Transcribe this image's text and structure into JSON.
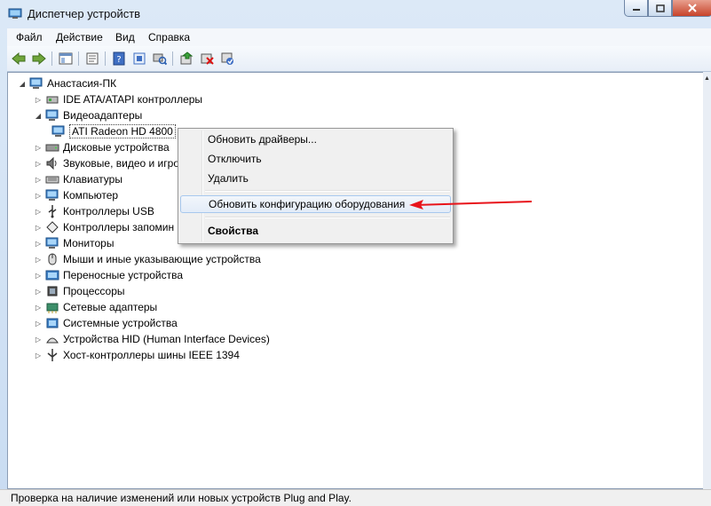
{
  "window": {
    "title": "Диспетчер устройств"
  },
  "menu": {
    "file": "Файл",
    "action": "Действие",
    "view": "Вид",
    "help": "Справка"
  },
  "tree": {
    "root": "Анастасия-ПК",
    "ide": "IDE ATA/ATAPI контроллеры",
    "video": "Видеоадаптеры",
    "video_child": "ATI Radeon HD 4800",
    "disks": "Дисковые устройства",
    "sound": "Звуковые, видео и игро",
    "keyboards": "Клавиатуры",
    "computer": "Компьютер",
    "usb": "Контроллеры USB",
    "storage": "Контроллеры запомин",
    "monitors": "Мониторы",
    "mice": "Мыши и иные указывающие устройства",
    "portable": "Переносные устройства",
    "cpus": "Процессоры",
    "network": "Сетевые адаптеры",
    "system": "Системные устройства",
    "hid": "Устройства HID (Human Interface Devices)",
    "ieee": "Хост-контроллеры шины IEEE 1394"
  },
  "context_menu": {
    "update_drivers": "Обновить драйверы...",
    "disable": "Отключить",
    "uninstall": "Удалить",
    "scan_hardware": "Обновить конфигурацию оборудования",
    "properties": "Свойства"
  },
  "status": {
    "text": "Проверка на наличие изменений или новых устройств Plug and Play."
  },
  "colors": {
    "arrow": "#e8141b",
    "selection": "#a8c8ee"
  }
}
